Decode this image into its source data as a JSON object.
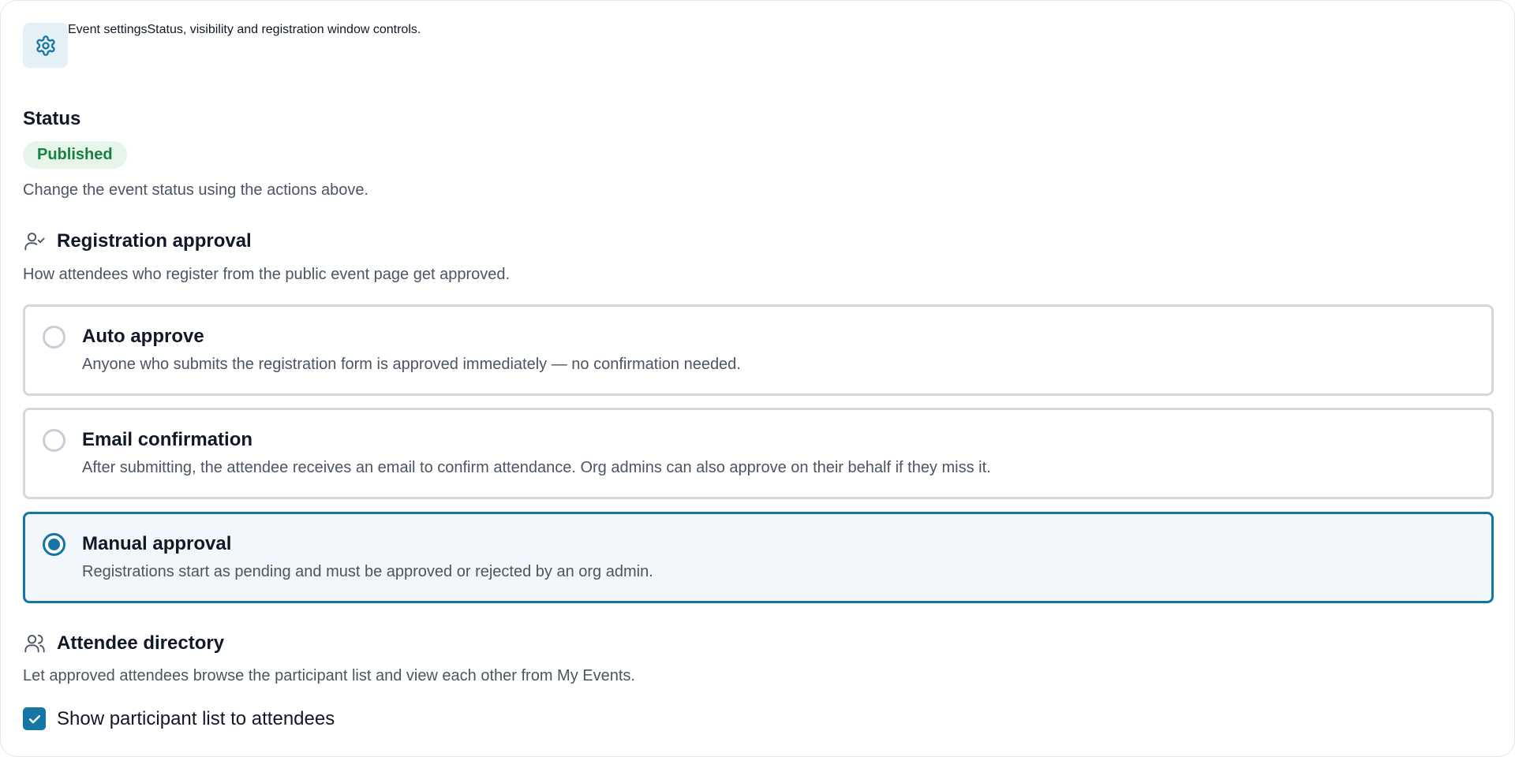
{
  "header": {
    "title": "Event settings",
    "subtitle": "Status, visibility and registration window controls.",
    "icon": "gear-icon"
  },
  "status": {
    "label": "Status",
    "badge": "Published",
    "badge_color": "#178043",
    "hint": "Change the event status using the actions above."
  },
  "registration": {
    "label": "Registration approval",
    "icon": "user-check-icon",
    "hint": "How attendees who register from the public event page get approved.",
    "selected": "manual",
    "options": [
      {
        "id": "auto",
        "title": "Auto approve",
        "description": "Anyone who submits the registration form is approved immediately — no confirmation needed."
      },
      {
        "id": "email",
        "title": "Email confirmation",
        "description": "After submitting, the attendee receives an email to confirm attendance. Org admins can also approve on their behalf if they miss it."
      },
      {
        "id": "manual",
        "title": "Manual approval",
        "description": "Registrations start as pending and must be approved or rejected by an org admin."
      }
    ]
  },
  "directory": {
    "label": "Attendee directory",
    "icon": "users-icon",
    "hint": "Let approved attendees browse the participant list and view each other from My Events.",
    "checkbox_label": "Show participant list to attendees",
    "checked": true
  },
  "colors": {
    "accent": "#1576a6",
    "success": "#178043"
  }
}
